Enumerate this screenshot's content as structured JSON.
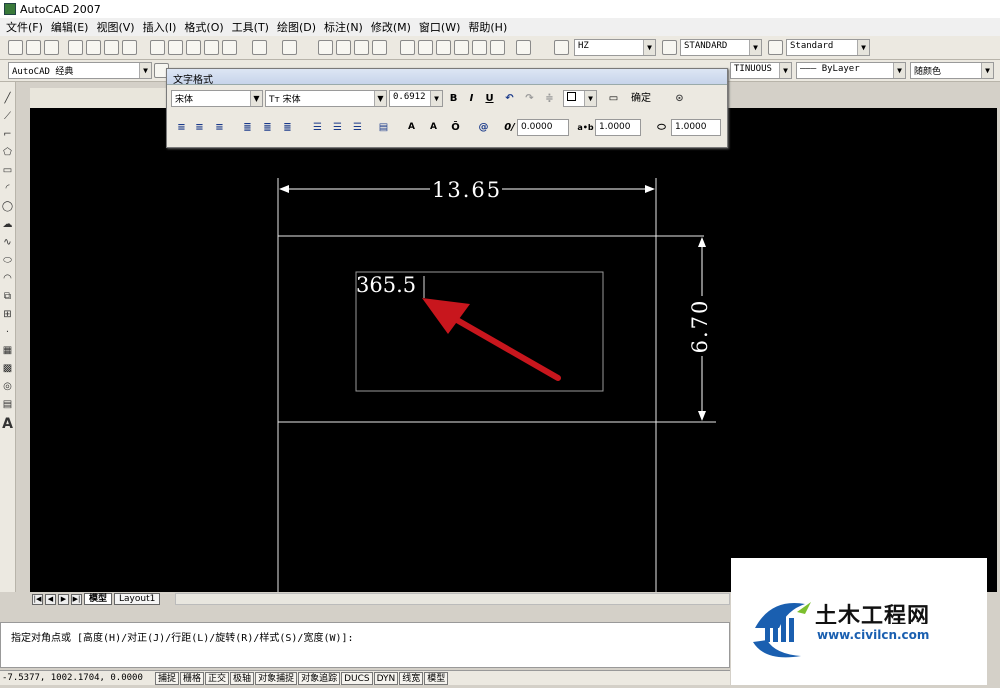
{
  "window": {
    "title": "AutoCAD 2007"
  },
  "menu": [
    "文件(F)",
    "编辑(E)",
    "视图(V)",
    "插入(I)",
    "格式(O)",
    "工具(T)",
    "绘图(D)",
    "标注(N)",
    "修改(M)",
    "窗口(W)",
    "帮助(H)"
  ],
  "toolbar1": {
    "text_style": "HZ",
    "dim_style": "STANDARD",
    "table_style": "Standard"
  },
  "toolbar2": {
    "workspace": "AutoCAD 经典",
    "linetype": "TINUOUS",
    "lineweight": "ByLayer",
    "color": "随颜色"
  },
  "text_format": {
    "title": "文字格式",
    "style": "宋体",
    "font": "宋体",
    "font_icon": "Tт",
    "height": "0.6912",
    "bold": "B",
    "italic": "I",
    "underline": "U",
    "ok_label": "确定",
    "oblique": "0.0000",
    "tracking": "1.0000",
    "width_factor": "1.0000",
    "label_a": "A",
    "label_a2": "A",
    "at": "@",
    "ab": "a•b"
  },
  "drawing": {
    "dim_horizontal": "13.65",
    "dim_vertical": "6.70",
    "edit_text": "365.5"
  },
  "tabs": {
    "model": "模型",
    "layout": "Layout1"
  },
  "command_line": "指定对角点或 [高度(H)/对正(J)/行距(L)/旋转(R)/样式(S)/宽度(W)]:",
  "status": {
    "coords": "-7.5377, 1002.1704, 0.0000",
    "buttons": [
      "捕捉",
      "栅格",
      "正交",
      "极轴",
      "对象捕捉",
      "对象追踪",
      "DUCS",
      "DYN",
      "线宽",
      "模型"
    ]
  },
  "watermark": {
    "name": "土木工程网",
    "url": "www.civilcn.com"
  },
  "colors": {
    "arrow": "#c8161d",
    "canvas": "#000000",
    "watermark_blue": "#1a5fb0"
  }
}
